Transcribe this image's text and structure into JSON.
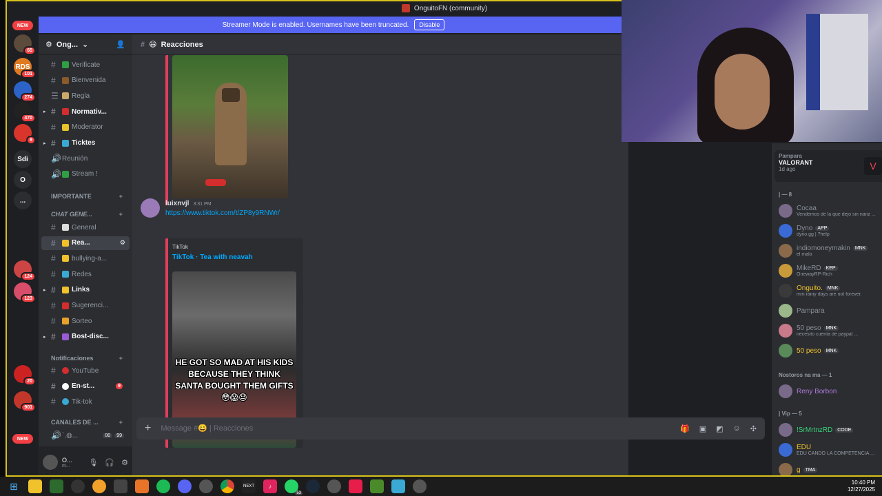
{
  "window": {
    "title": "OnguitoFN (community)"
  },
  "banner": {
    "text": "Streamer Mode is enabled. Usernames have been truncated.",
    "button": "Disable"
  },
  "rail": {
    "new_top": "NEW",
    "new_bottom": "NEW",
    "servers": [
      {
        "label": "",
        "badge": "65",
        "color": "#5c4a3a"
      },
      {
        "label": "RDS",
        "badge": "101",
        "color": "#e07a20"
      },
      {
        "label": "",
        "badge": "274",
        "color": "#2b63c8"
      },
      {
        "label": "",
        "badge": "470",
        "color": "#222"
      },
      {
        "label": "",
        "badge": "9",
        "color": "#d9352b"
      },
      {
        "label": "Sdi",
        "badge": "",
        "color": "#2b2d31"
      },
      {
        "label": "O",
        "badge": "",
        "color": "#2b2d31"
      },
      {
        "label": "...",
        "badge": "",
        "color": "#2b2d31"
      },
      {
        "label": "",
        "badge": "124",
        "color": "#c44"
      },
      {
        "label": "",
        "badge": "123",
        "color": "#d84d6a"
      },
      {
        "label": "",
        "badge": "20",
        "color": "#c22"
      },
      {
        "label": "",
        "badge": "901",
        "color": "#c3372a"
      }
    ]
  },
  "sidebar": {
    "server_name": "Ong...",
    "channels": [
      {
        "name": "Verificate",
        "type": "text",
        "emoji_color": "#2ea043",
        "bold": false
      },
      {
        "name": "Bienvenida",
        "type": "text",
        "emoji_color": "#8a5a2b",
        "bold": false
      },
      {
        "name": "Regla",
        "type": "rules",
        "emoji_color": "#c9a86a",
        "bold": false
      },
      {
        "name": "Normativ...",
        "type": "text",
        "emoji_color": "#d42d2d",
        "bold": true
      },
      {
        "name": "Moderator",
        "type": "text",
        "emoji_color": "#e8c32a",
        "bold": false
      },
      {
        "name": "Ticktes",
        "type": "text",
        "emoji_color": "#3aa9d4",
        "bold": true
      },
      {
        "name": "Reunión",
        "type": "voice",
        "emoji_color": "",
        "bold": false
      },
      {
        "name": "Stream !",
        "type": "voice",
        "emoji_color": "#2ea043",
        "bold": false
      }
    ],
    "cat_importante": "IMPORTANTE",
    "cat_chat": "CHAT GENE...",
    "chat_channels": [
      {
        "name": "General",
        "emoji_color": "#ddd",
        "bold": false
      },
      {
        "name": "Rea...",
        "emoji_color": "#f0c22b",
        "bold": true,
        "selected": true
      },
      {
        "name": "bullying-a...",
        "emoji_color": "#f0c22b",
        "bold": false
      },
      {
        "name": "Redes",
        "emoji_color": "#3aa9d4",
        "bold": false
      },
      {
        "name": "Links",
        "emoji_color": "#f0c22b",
        "bold": true
      },
      {
        "name": "Sugerenci...",
        "emoji_color": "#d42d2d",
        "bold": false
      },
      {
        "name": "Sorteo",
        "emoji_color": "#e8a22a",
        "bold": false
      },
      {
        "name": "Bost-disc...",
        "emoji_color": "#9a5ad4",
        "bold": true
      }
    ],
    "cat_notif": "Notificaciones",
    "notif_channels": [
      {
        "name": "YouTube",
        "emoji_color": "#d42d2d",
        "bold": false
      },
      {
        "name": "En-st...",
        "emoji_color": "#fff",
        "bold": true,
        "badge": "9"
      },
      {
        "name": "Tik-tok",
        "emoji_color": "#3aa9d4",
        "bold": false
      }
    ],
    "cat_canales": "CANALES DE ...",
    "voice_user": "`.◍...",
    "voice_counts": [
      "00",
      "99"
    ],
    "user_name": "O...",
    "user_status": "m..."
  },
  "chat": {
    "channel_name": "Reacciones",
    "message": {
      "author": "luixnvjl",
      "time": "3:31 PM",
      "link": "https://www.tiktok.com/t/ZP8y9RNWr/",
      "embed_provider": "TikTok",
      "embed_title": "TikTok · Tea with neavah",
      "caption": "HE GOT SO MAD AT HIS KIDS BECAUSE THEY THINK SANTA BOUGHT THEM GIFTS 😳😱😓"
    },
    "composer_placeholder": "Message #😄 | Reacciones"
  },
  "members": {
    "activity": {
      "user": "Pampara",
      "game": "VALORANT",
      "time": "1d ago"
    },
    "group1": "| — 8",
    "list1": [
      {
        "name": "Cocaa",
        "status": "Vendemos de la que dejo sin nariz ...",
        "color": "#8a8f98",
        "tag": ""
      },
      {
        "name": "Dyno",
        "status": "dyno.gg | ?help",
        "color": "#8a8f98",
        "tag": "APP"
      },
      {
        "name": "indiomoneymakin",
        "status": "el malo",
        "color": "#8a8f98",
        "tag": "MNK"
      },
      {
        "name": "MikeRD",
        "status": "OnewayRP-Rich",
        "color": "#8a8f98",
        "tag": "KEP"
      },
      {
        "name": "Onguito.",
        "status": "mm rainy days are not forever.",
        "color": "#f0c22b",
        "tag": "MNK"
      },
      {
        "name": "Pampara",
        "status": "",
        "color": "#8a8f98",
        "tag": ""
      },
      {
        "name": "50 peso",
        "status": "necesito cuenta de paypal ...",
        "color": "#8a8f98",
        "tag": "MNK"
      },
      {
        "name": "50 peso",
        "status": "",
        "color": "#f0c22b",
        "tag": "MNK"
      }
    ],
    "group2": "Nostoros na ma — 1",
    "list2": [
      {
        "name": "Reny Borbon",
        "status": "",
        "color": "#b07adb",
        "tag": ""
      }
    ],
    "group3": "| Vip — 5",
    "list3": [
      {
        "name": "!SrMrtnzRD",
        "status": "",
        "color": "#3ad17a",
        "tag": "CODE"
      },
      {
        "name": "EDU",
        "status": "EDU CANDO LA COMPETENCIA ...",
        "color": "#f0c22b",
        "tag": ""
      },
      {
        "name": "g",
        "status": "",
        "color": "#f0c22b",
        "tag": "TMA"
      }
    ]
  },
  "taskbar": {
    "time": "10:40 PM",
    "date": "12/27/2025",
    "whatsapp_badge": "53",
    "next_label": "NEXT"
  }
}
